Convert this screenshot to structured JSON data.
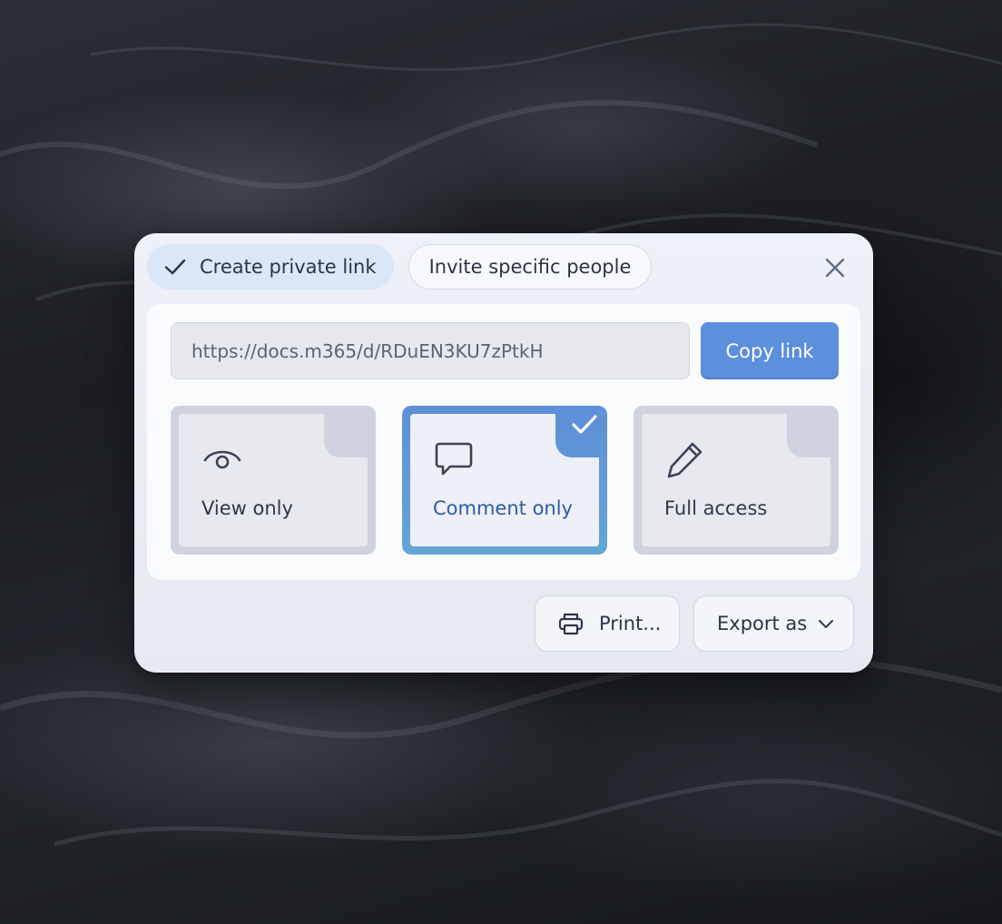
{
  "tabs": {
    "private_link": "Create private link",
    "invite": "Invite specific people"
  },
  "link": {
    "url": "https://docs.m365/d/RDuEN3KU7zPtkH",
    "copy_label": "Copy link"
  },
  "access_options": [
    {
      "label": "View only",
      "icon": "eye-icon",
      "selected": false
    },
    {
      "label": "Comment only",
      "icon": "comment-icon",
      "selected": true
    },
    {
      "label": "Full access",
      "icon": "pencil-icon",
      "selected": false
    }
  ],
  "footer": {
    "print_label": "Print...",
    "export_label": "Export as"
  },
  "colors": {
    "accent": "#5c8fdc",
    "tab_active_bg": "#dbe6f8",
    "dialog_bg": "#eef1f8"
  }
}
